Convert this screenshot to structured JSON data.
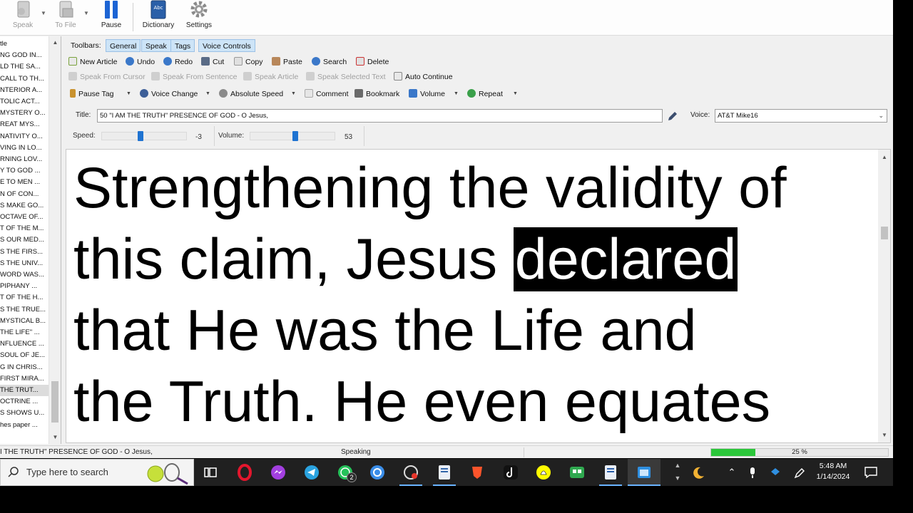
{
  "main_toolbar": {
    "speak": "Speak",
    "to_file": "To File",
    "pause": "Pause",
    "dictionary": "Dictionary",
    "settings": "Settings"
  },
  "article_list": {
    "items": [
      "tle",
      "NG GOD IN...",
      "LD THE SA...",
      "CALL TO TH...",
      "NTERIOR A...",
      "TOLIC ACT...",
      "MYSTERY O...",
      "REAT MYS...",
      "NATIVITY O...",
      "VING IN LO...",
      "RNING LOV...",
      "Y TO GOD ...",
      "E TO MEN ...",
      "N OF CON...",
      "S MAKE GO...",
      "OCTAVE OF...",
      "T OF THE M...",
      "S OUR MED...",
      "S THE FIRS...",
      "S THE UNIV...",
      "WORD WAS...",
      "PIPHANY ...",
      "T OF THE H...",
      "S THE TRUE...",
      "MYSTICAL B...",
      "THE LIFE\" ...",
      "NFLUENCE ...",
      "SOUL OF JE...",
      "G IN CHRIS...",
      "FIRST MIRA...",
      "THE TRUT...",
      "OCTRINE ...",
      "S SHOWS U...",
      "hes paper ..."
    ],
    "selected_index": 30
  },
  "toolbars": {
    "label": "Toolbars:",
    "tabs": [
      "General",
      "Speak",
      "Tags",
      "Voice Controls"
    ],
    "row1": {
      "new_article": "New Article",
      "undo": "Undo",
      "redo": "Redo",
      "cut": "Cut",
      "copy": "Copy",
      "paste": "Paste",
      "search": "Search",
      "delete": "Delete"
    },
    "row2": {
      "speak_from_cursor": "Speak From Cursor",
      "speak_from_sentence": "Speak From Sentence",
      "speak_article": "Speak Article",
      "speak_selected_text": "Speak Selected Text",
      "auto_continue": "Auto Continue"
    },
    "row3": {
      "pause_tag": "Pause Tag",
      "voice_change": "Voice Change",
      "absolute_speed": "Absolute Speed",
      "comment": "Comment",
      "bookmark": "Bookmark",
      "volume": "Volume",
      "repeat": "Repeat"
    }
  },
  "title_row": {
    "title_label": "Title:",
    "title_value": "50 \"I AM THE TRUTH\" PRESENCE OF GOD - O Jesus,",
    "voice_label": "Voice:",
    "voice_value": "AT&T Mike16"
  },
  "sliders": {
    "speed_label": "Speed:",
    "speed_value": "-3",
    "speed_fraction": 0.45,
    "volume_label": "Volume:",
    "volume_value": "53",
    "volume_fraction": 0.53
  },
  "text_area": {
    "line1": "Strengthening the validity of",
    "line2_before": "this claim, Jesus ",
    "line2_highlight": "declared",
    "line3": "that He was the Life and",
    "line4": "the Truth. He even equates"
  },
  "status_bar": {
    "title": "I THE TRUTH\" PRESENCE OF GOD - O Jesus,",
    "state": "Speaking",
    "progress_percent": 25,
    "progress_label": "25 %"
  },
  "taskbar": {
    "search_placeholder": "Type here to search",
    "time": "5:48 AM",
    "date": "1/14/2024",
    "telegram_badge": "2"
  },
  "colors": {
    "tab_bg": "#cde4f7",
    "progress_fill": "#2bc63a",
    "slider_thumb": "#1f73d1",
    "taskbar_bg": "#202020"
  }
}
